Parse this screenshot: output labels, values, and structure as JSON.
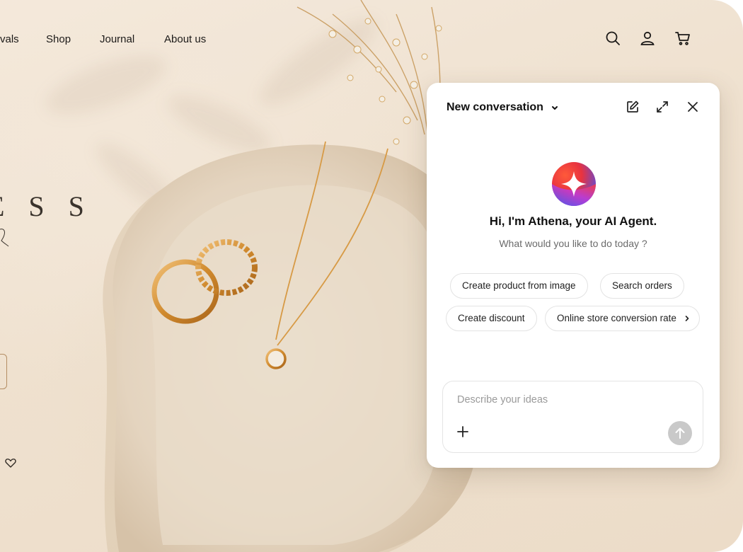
{
  "nav": {
    "items": [
      {
        "label": "vals"
      },
      {
        "label": "Shop"
      },
      {
        "label": "Journal"
      },
      {
        "label": "About us"
      }
    ],
    "icons": [
      "search-icon",
      "user-icon",
      "cart-icon"
    ]
  },
  "hero": {
    "text": "E S S"
  },
  "chat": {
    "title": "New conversation",
    "greeting": "Hi, I'm Athena, your AI Agent.",
    "subtitle": "What would you like to do today ?",
    "suggestions": [
      {
        "label": "Create product from image"
      },
      {
        "label": "Search orders"
      },
      {
        "label": "Create discount"
      },
      {
        "label": "Online store conversion rate"
      }
    ],
    "input": {
      "placeholder": "Describe your ideas",
      "value": ""
    },
    "header_icons": [
      "edit-icon",
      "expand-icon",
      "close-icon"
    ]
  },
  "colors": {
    "background": "#efe1cf",
    "panel": "#ffffff",
    "text": "#111111",
    "muted": "#6b6b6b",
    "send_disabled": "#c9c9c9",
    "gold": "#d4943a"
  }
}
